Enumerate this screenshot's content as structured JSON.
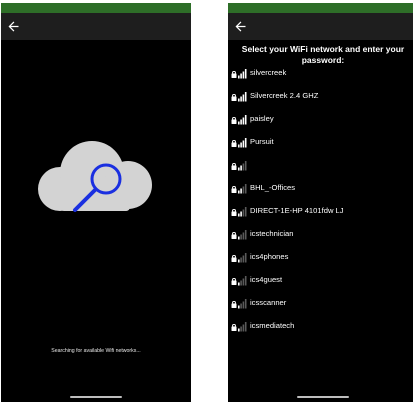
{
  "colors": {
    "status_bar": "#2e6e28",
    "app_bar": "#1e1e1e",
    "screen_bg": "#000000",
    "cloud": "#d3d3d3",
    "magnifier": "#1a2fe0",
    "text": "#ffffff"
  },
  "left_screen": {
    "back_icon": "arrow-left-icon",
    "illustration_icon": "cloud-search-icon",
    "status_text": "Searching for available Wifi networks..."
  },
  "right_screen": {
    "back_icon": "arrow-left-icon",
    "heading": "Select your WiFi network and enter your password:",
    "networks": [
      {
        "name": "silvercreek",
        "signal": 4,
        "locked": true
      },
      {
        "name": "Silvercreek 2.4 GHZ",
        "signal": 4,
        "locked": true
      },
      {
        "name": "paisley",
        "signal": 4,
        "locked": true
      },
      {
        "name": "Pursuit",
        "signal": 4,
        "locked": true
      },
      {
        "name": "",
        "signal": 2,
        "locked": true
      },
      {
        "name": "BHL_-Offices",
        "signal": 2,
        "locked": true
      },
      {
        "name": "DIRECT-1E-HP 4101fdw LJ",
        "signal": 2,
        "locked": true
      },
      {
        "name": "icstechnician",
        "signal": 1,
        "locked": true
      },
      {
        "name": "ics4phones",
        "signal": 1,
        "locked": true
      },
      {
        "name": "ics4guest",
        "signal": 1,
        "locked": true
      },
      {
        "name": "icsscanner",
        "signal": 1,
        "locked": true
      },
      {
        "name": "icsmediatech",
        "signal": 1,
        "locked": true
      }
    ]
  }
}
